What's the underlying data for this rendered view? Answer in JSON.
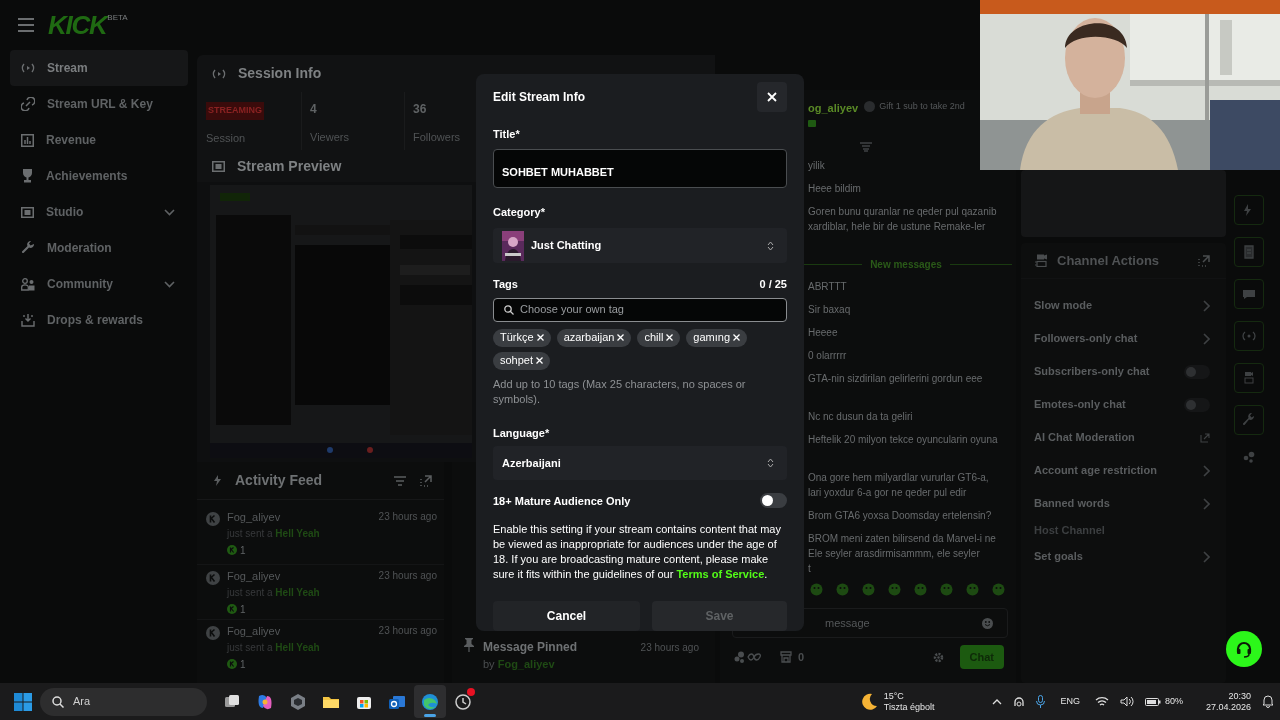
{
  "app": {
    "logo": "KICK",
    "logo_badge": "BETA"
  },
  "sidebar": {
    "items": [
      {
        "label": "Stream",
        "selected": true,
        "expandable": false
      },
      {
        "label": "Stream URL & Key",
        "selected": false,
        "expandable": false
      },
      {
        "label": "Revenue",
        "selected": false,
        "expandable": false
      },
      {
        "label": "Achievements",
        "selected": false,
        "expandable": false
      },
      {
        "label": "Studio",
        "selected": false,
        "expandable": true
      },
      {
        "label": "Moderation",
        "selected": false,
        "expandable": false
      },
      {
        "label": "Community",
        "selected": false,
        "expandable": true
      },
      {
        "label": "Drops & rewards",
        "selected": false,
        "expandable": false
      }
    ]
  },
  "session_info": {
    "title": "Session Info",
    "status_badge": "STREAMING",
    "status_label": "Session",
    "stats": [
      {
        "value": "4",
        "label": "Viewers"
      },
      {
        "value": "36",
        "label": "Followers"
      }
    ]
  },
  "stream_preview": {
    "title": "Stream Preview"
  },
  "activity_feed": {
    "title": "Activity Feed",
    "items": [
      {
        "user": "Fog_aliyev",
        "text": "just sent a",
        "gift": "Hell Yeah",
        "count": "1",
        "time": "23 hours ago"
      },
      {
        "user": "Fog_aliyev",
        "text": "just sent a",
        "gift": "Hell Yeah",
        "count": "1",
        "time": "23 hours ago"
      },
      {
        "user": "Fog_aliyev",
        "text": "just sent a",
        "gift": "Hell Yeah",
        "count": "1",
        "time": "23 hours ago"
      }
    ]
  },
  "pinned": {
    "title": "Message Pinned",
    "by": "by",
    "user": "Fog_aliyev",
    "time": "23 hours ago"
  },
  "chat": {
    "header_user": "og_aliyev",
    "gift_prompt": "Gift 1 sub to take 2nd",
    "messages": [
      {
        "kind": "message",
        "lines": [
          "yilik"
        ],
        "hidden_line": false
      },
      {
        "kind": "message",
        "lines": [
          "Heee bildim"
        ],
        "hidden_line": false
      },
      {
        "kind": "message",
        "lines": [
          "Goren bunu quranlar ne qeder pul qazanib",
          "xardiblar, hele bir de ustune Remake-ler"
        ],
        "hidden_line": true
      },
      {
        "kind": "divider",
        "text": "New messages"
      },
      {
        "kind": "message",
        "lines": [
          "ABRTTT"
        ],
        "hidden_line": false
      },
      {
        "kind": "message",
        "lines": [
          "Sir baxaq"
        ],
        "hidden_line": false
      },
      {
        "kind": "message",
        "lines": [
          "Heeee"
        ],
        "hidden_line": false
      },
      {
        "kind": "message",
        "lines": [
          "0 olarrrrr"
        ],
        "hidden_line": false
      },
      {
        "kind": "message",
        "lines": [
          "GTA-nin sizdirilan gelirlerini gordun eee"
        ],
        "hidden_line": true
      },
      {
        "kind": "message",
        "lines": [
          "Nc nc dusun da ta geliri"
        ],
        "hidden_line": false
      },
      {
        "kind": "message",
        "lines": [
          "Heftelik 20 milyon tekce oyuncularin oyuna"
        ],
        "hidden_line": true
      },
      {
        "kind": "message",
        "lines": [
          "Ona gore hem milyardlar vururlar GT6-a,",
          "lari yoxdur 6-a gor ne qeder pul edir"
        ],
        "hidden_line": false
      },
      {
        "kind": "message",
        "lines": [
          "Brom GTA6 yoxsa Doomsday ertelensin?"
        ],
        "hidden_line": false
      },
      {
        "kind": "message",
        "lines": [
          "BROM meni zaten bilirsend da Marvel-i ne",
          "Ele seyler arasdirmisammm, ele seyler",
          "t"
        ],
        "hidden_line": false
      }
    ],
    "input_placeholder": "message",
    "points": "0",
    "send_button": "Chat"
  },
  "channel_actions": {
    "title": "Channel Actions",
    "items": [
      {
        "label": "Slow mode",
        "kind": "arrow",
        "disabled": false
      },
      {
        "label": "Followers-only chat",
        "kind": "arrow",
        "disabled": false
      },
      {
        "label": "Subscribers-only chat",
        "kind": "toggle",
        "on": false,
        "disabled": false
      },
      {
        "label": "Emotes-only chat",
        "kind": "toggle",
        "on": false,
        "disabled": false
      },
      {
        "label": "AI Chat Moderation",
        "kind": "external",
        "disabled": false
      },
      {
        "label": "Account age restriction",
        "kind": "arrow",
        "disabled": false
      },
      {
        "label": "Banned words",
        "kind": "arrow",
        "disabled": false
      },
      {
        "label": "Host Channel",
        "kind": "plain",
        "disabled": true
      },
      {
        "label": "Set goals",
        "kind": "arrow",
        "disabled": false
      }
    ]
  },
  "modal": {
    "title": "Edit Stream Info",
    "title_label": "Title*",
    "title_value": "SOHBET MUHABBET",
    "category_label": "Category*",
    "category_value": "Just Chatting",
    "tags_label": "Tags",
    "tags_count": "0 / 25",
    "tags_placeholder": "Choose your own tag",
    "tags": [
      "Türkçe",
      "azarbaijan",
      "chill",
      "gamıng",
      "sohpet"
    ],
    "tags_hint": "Add up to 10 tags (Max 25 characters, no spaces or symbols).",
    "language_label": "Language*",
    "language_value": "Azerbaijani",
    "mature_label": "18+ Mature Audience Only",
    "mature_on": false,
    "mature_text": "Enable this setting if your stream contains content that may be viewed as inappropriate for audiences under the age of 18. If you are broadcasting mature content, please make sure it fits within the guidelines of our",
    "mature_link": "Terms of Service",
    "mature_end": ".",
    "buttons": [
      {
        "label": "Cancel",
        "disabled": false
      },
      {
        "label": "Save",
        "disabled": true
      }
    ]
  },
  "taskbar": {
    "search": "Ara",
    "apps": [
      {
        "selected": false,
        "badge": false
      },
      {
        "selected": false,
        "badge": false
      },
      {
        "selected": false,
        "badge": false
      },
      {
        "selected": false,
        "badge": false
      },
      {
        "selected": false,
        "badge": false
      },
      {
        "selected": false,
        "badge": false
      },
      {
        "selected": true,
        "badge": false
      },
      {
        "selected": false,
        "badge": true
      }
    ],
    "weather_temp": "15°C",
    "weather_desc": "Tiszta égbolt",
    "language": "ENG",
    "battery": "80%",
    "time": "20:30",
    "date": "27.04.2026"
  }
}
